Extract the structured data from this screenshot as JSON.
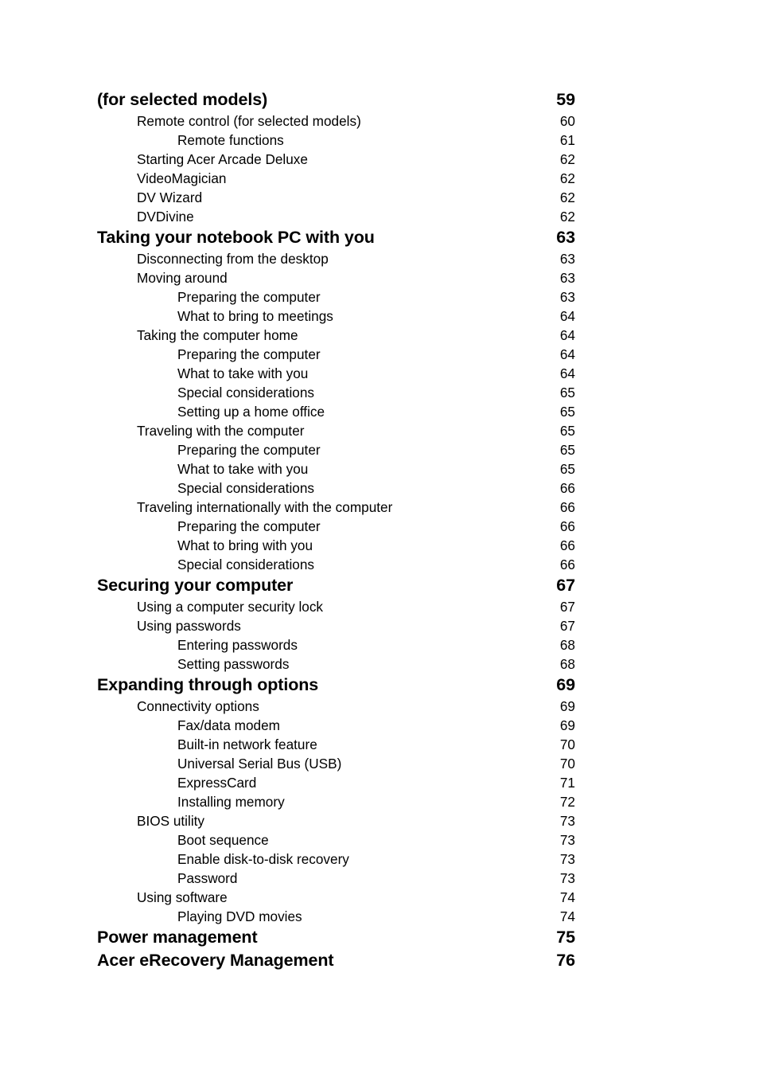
{
  "document": {
    "type": "table-of-contents",
    "page_background": "#ffffff",
    "text_color": "#000000"
  },
  "toc": {
    "entries": [
      {
        "title": "(for selected models)",
        "page": "59",
        "level": 0
      },
      {
        "title": "Remote control (for selected models)",
        "page": "60",
        "level": 1
      },
      {
        "title": "Remote functions",
        "page": "61",
        "level": 2
      },
      {
        "title": "Starting Acer Arcade Deluxe",
        "page": "62",
        "level": 1
      },
      {
        "title": "VideoMagician",
        "page": "62",
        "level": 1
      },
      {
        "title": "DV Wizard",
        "page": "62",
        "level": 1
      },
      {
        "title": "DVDivine",
        "page": "62",
        "level": 1
      },
      {
        "title": "Taking your notebook PC with you",
        "page": "63",
        "level": 0
      },
      {
        "title": "Disconnecting from the desktop",
        "page": "63",
        "level": 1
      },
      {
        "title": "Moving around",
        "page": "63",
        "level": 1
      },
      {
        "title": "Preparing the computer",
        "page": "63",
        "level": 2
      },
      {
        "title": "What to bring to meetings",
        "page": "64",
        "level": 2
      },
      {
        "title": "Taking the computer home",
        "page": "64",
        "level": 1
      },
      {
        "title": "Preparing the computer",
        "page": "64",
        "level": 2
      },
      {
        "title": "What to take with you",
        "page": "64",
        "level": 2
      },
      {
        "title": "Special considerations",
        "page": "65",
        "level": 2
      },
      {
        "title": "Setting up a home office",
        "page": "65",
        "level": 2
      },
      {
        "title": "Traveling with the computer",
        "page": "65",
        "level": 1
      },
      {
        "title": "Preparing the computer",
        "page": "65",
        "level": 2
      },
      {
        "title": "What to take with you",
        "page": "65",
        "level": 2
      },
      {
        "title": "Special considerations",
        "page": "66",
        "level": 2
      },
      {
        "title": "Traveling internationally with the computer",
        "page": "66",
        "level": 1
      },
      {
        "title": "Preparing the computer",
        "page": "66",
        "level": 2
      },
      {
        "title": "What to bring with you",
        "page": "66",
        "level": 2
      },
      {
        "title": "Special considerations",
        "page": "66",
        "level": 2
      },
      {
        "title": "Securing your computer",
        "page": "67",
        "level": 0
      },
      {
        "title": "Using a computer security lock",
        "page": "67",
        "level": 1
      },
      {
        "title": "Using passwords",
        "page": "67",
        "level": 1
      },
      {
        "title": "Entering passwords",
        "page": "68",
        "level": 2
      },
      {
        "title": "Setting passwords",
        "page": "68",
        "level": 2
      },
      {
        "title": "Expanding through options",
        "page": "69",
        "level": 0
      },
      {
        "title": "Connectivity options",
        "page": "69",
        "level": 1
      },
      {
        "title": "Fax/data modem",
        "page": "69",
        "level": 2
      },
      {
        "title": "Built-in network feature",
        "page": "70",
        "level": 2
      },
      {
        "title": "Universal Serial Bus (USB)",
        "page": "70",
        "level": 2
      },
      {
        "title": "ExpressCard",
        "page": "71",
        "level": 2
      },
      {
        "title": "Installing memory",
        "page": "72",
        "level": 2
      },
      {
        "title": "BIOS utility",
        "page": "73",
        "level": 1
      },
      {
        "title": "Boot sequence",
        "page": "73",
        "level": 2
      },
      {
        "title": "Enable disk-to-disk recovery",
        "page": "73",
        "level": 2
      },
      {
        "title": "Password",
        "page": "73",
        "level": 2
      },
      {
        "title": "Using software",
        "page": "74",
        "level": 1
      },
      {
        "title": "Playing DVD movies",
        "page": "74",
        "level": 2
      },
      {
        "title": "Power management",
        "page": "75",
        "level": 0
      },
      {
        "title": "Acer eRecovery Management",
        "page": "76",
        "level": 0
      }
    ]
  }
}
